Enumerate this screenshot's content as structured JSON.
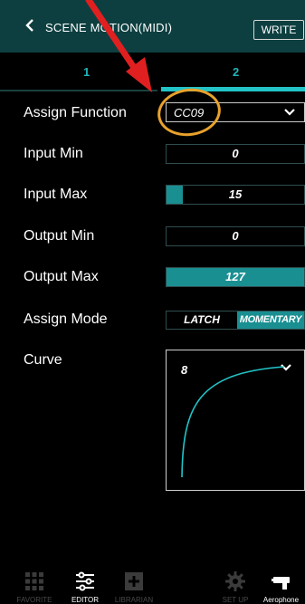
{
  "header": {
    "back_icon": "chevron-left-icon",
    "title": "SCENE MOTION(MIDI)",
    "write_label": "WRITE"
  },
  "tabs": [
    {
      "label": "1",
      "active": false
    },
    {
      "label": "2",
      "active": true
    }
  ],
  "settings": {
    "assign_function": {
      "label": "Assign Function",
      "value": "CC09"
    },
    "input_min": {
      "label": "Input Min",
      "value": "0",
      "level": 0.0
    },
    "input_max": {
      "label": "Input Max",
      "value": "15",
      "level": 0.12
    },
    "output_min": {
      "label": "Output Min",
      "value": "0",
      "level": 0.0
    },
    "output_max": {
      "label": "Output Max",
      "value": "127",
      "level": 1.0
    },
    "assign_mode": {
      "label": "Assign Mode",
      "options": [
        "LATCH",
        "MOMENTARY"
      ],
      "selected": "MOMENTARY"
    },
    "curve": {
      "label": "Curve",
      "value": "8"
    }
  },
  "bottom_nav": [
    {
      "label": "FAVORITE",
      "icon": "grid-icon",
      "active": false
    },
    {
      "label": "EDITOR",
      "icon": "sliders-icon",
      "active": true
    },
    {
      "label": "LIBRARIAN",
      "icon": "plus-square-icon",
      "active": false
    },
    {
      "label": "SET UP",
      "icon": "gear-icon",
      "active": false
    },
    {
      "label": "Aerophone",
      "icon": "device-icon",
      "active": true
    }
  ],
  "colors": {
    "header_bg": "#0d3f40",
    "accent": "#22c4c8",
    "fill": "#1a8f92",
    "annotation_ring": "#e8a22c",
    "annotation_arrow": "#e02020"
  }
}
